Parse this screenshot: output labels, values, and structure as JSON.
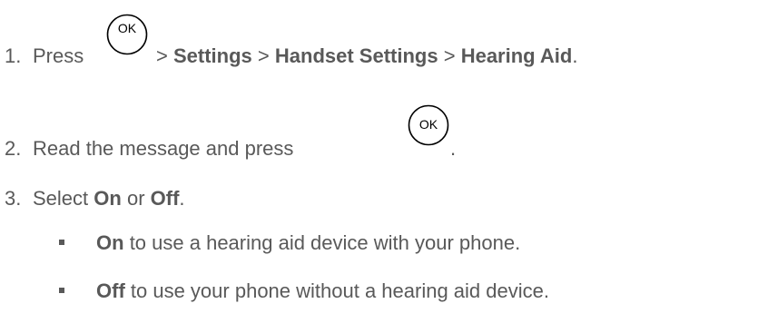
{
  "steps": [
    {
      "number": "1.",
      "text_before": "Press",
      "parts": [
        {
          "sep": ">",
          "label": "Settings"
        },
        {
          "sep": ">",
          "label": "Handset Settings"
        },
        {
          "sep": ">",
          "label": "Hearing Aid"
        }
      ],
      "end": "."
    },
    {
      "number": "2.",
      "text_before": "Read the message and press",
      "end": "."
    },
    {
      "number": "3.",
      "text_before": "Select",
      "option_on": "On",
      "connector": "or",
      "option_off": "Off",
      "end": "."
    }
  ],
  "bullets": [
    {
      "label": "On",
      "text": "to use a hearing aid device with your phone."
    },
    {
      "label": "Off",
      "text": "to use your phone without a hearing aid device."
    }
  ],
  "ok_icon": {
    "label": "OK",
    "name": "ok-button-icon"
  }
}
